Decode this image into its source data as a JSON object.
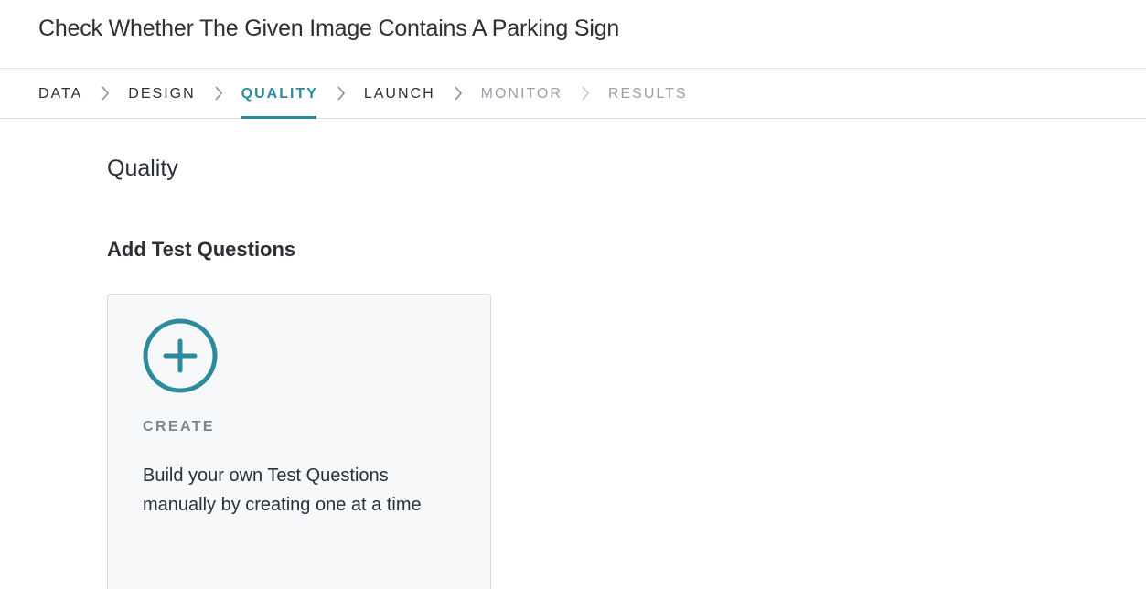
{
  "header": {
    "title": "Check Whether The Given Image Contains A Parking Sign"
  },
  "tabs": [
    {
      "label": "DATA",
      "state": "default"
    },
    {
      "label": "DESIGN",
      "state": "default"
    },
    {
      "label": "QUALITY",
      "state": "active"
    },
    {
      "label": "LAUNCH",
      "state": "default"
    },
    {
      "label": "MONITOR",
      "state": "disabled"
    },
    {
      "label": "RESULTS",
      "state": "disabled"
    }
  ],
  "main": {
    "section_title": "Quality",
    "subsection_title": "Add Test Questions",
    "create_card": {
      "icon": "plus-circle-icon",
      "label": "CREATE",
      "description": "Build your own Test Questions manually by creating one at a time"
    }
  },
  "colors": {
    "accent": "#2b8a9c",
    "text": "#2b2f36",
    "muted": "#9aa0a8",
    "card_bg": "#f7f8fa"
  }
}
